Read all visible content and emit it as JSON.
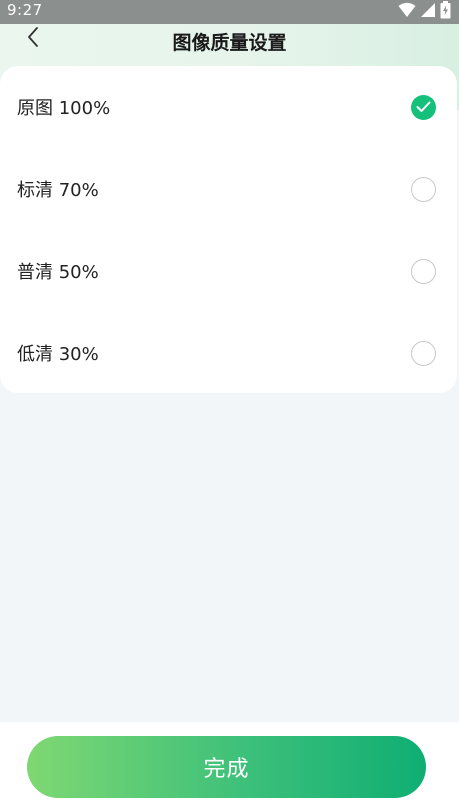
{
  "status_bar": {
    "time": "9:27",
    "icons": [
      "wifi-icon",
      "signal-icon",
      "battery-icon"
    ]
  },
  "header": {
    "title": "图像质量设置",
    "back_icon": "chevron-left-icon"
  },
  "options": [
    {
      "label": "原图 100%",
      "selected": true
    },
    {
      "label": "标清 70%",
      "selected": false
    },
    {
      "label": "普清 50%",
      "selected": false
    },
    {
      "label": "低清 30%",
      "selected": false
    }
  ],
  "footer": {
    "done_label": "完成"
  },
  "colors": {
    "accent": "#14c07a",
    "button_gradient_start": "#7fd872",
    "button_gradient_end": "#0fae73",
    "page_background": "#f2f6f9"
  }
}
